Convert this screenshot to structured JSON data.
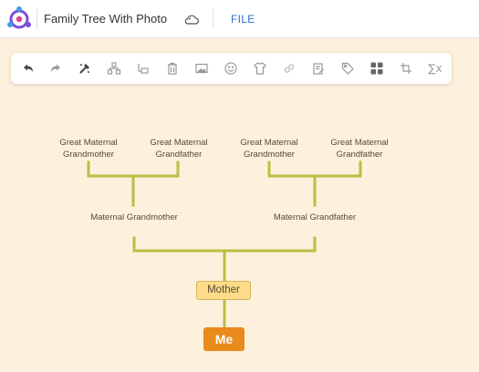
{
  "app": {
    "title": "Family Tree With Photo",
    "file_menu": "FILE",
    "logo_icon": "app-logo-icon",
    "cloud_icon": "cloud-sync-icon"
  },
  "toolbar": {
    "icons": [
      "undo-icon",
      "redo-icon",
      "format-painter-icon",
      "hierarchy-icon",
      "sub-topic-icon",
      "delete-icon",
      "image-icon",
      "emoji-icon",
      "theme-icon",
      "link-icon",
      "note-icon",
      "tag-icon",
      "layout-icon",
      "boundary-icon",
      "formula-icon"
    ],
    "formula_glyph": "∑x"
  },
  "tree": {
    "great_maternal_grandmother_1": "Great Maternal Grandmother",
    "great_maternal_grandfather_1": "Great Maternal Grandfather",
    "great_maternal_grandmother_2": "Great Maternal Grandmother",
    "great_maternal_grandfather_2": "Great Maternal Grandfather",
    "maternal_grandmother": "Maternal Grandmother",
    "maternal_grandfather": "Maternal Grandfather",
    "mother": "Mother",
    "me": "Me"
  },
  "colors": {
    "background": "#fdf0dc",
    "connector": "#b9c042",
    "mother_fill": "#fcdc8a",
    "me_fill": "#ea8a1c",
    "file_link": "#2c6fce"
  }
}
